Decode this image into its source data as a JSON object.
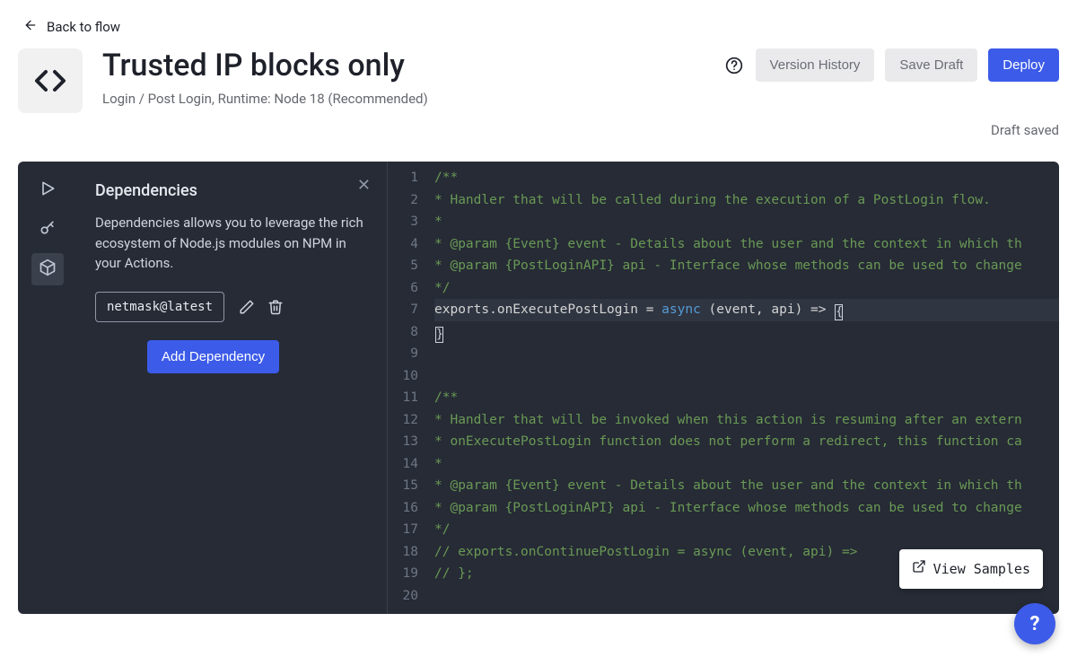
{
  "back_label": "Back to flow",
  "header": {
    "title": "Trusted IP blocks only",
    "subtitle": "Login / Post Login, Runtime: Node 18 (Recommended)",
    "help_tooltip": "Help",
    "version_history": "Version History",
    "save_draft": "Save Draft",
    "deploy": "Deploy",
    "draft_status": "Draft saved"
  },
  "rail": {
    "run": "Run",
    "secrets": "Secrets",
    "dependencies": "Dependencies"
  },
  "panel": {
    "title": "Dependencies",
    "description": "Dependencies allows you to leverage the rich ecosystem of Node.js modules on NPM in your Actions.",
    "dependency": "netmask@latest",
    "edit": "Edit",
    "delete": "Delete",
    "add_button": "Add Dependency"
  },
  "code": {
    "lines": [
      "/**",
      "* Handler that will be called during the execution of a PostLogin flow.",
      "*",
      "* @param {Event} event - Details about the user and the context in which th",
      "* @param {PostLoginAPI} api - Interface whose methods can be used to change",
      "*/",
      "exports.onExecutePostLogin = async (event, api) => {",
      "}",
      "",
      "",
      "/**",
      "* Handler that will be invoked when this action is resuming after an extern",
      "* onExecutePostLogin function does not perform a redirect, this function ca",
      "*",
      "* @param {Event} event - Details about the user and the context in which th",
      "* @param {PostLoginAPI} api - Interface whose methods can be used to change",
      "*/",
      "// exports.onContinuePostLogin = async (event, api) =>",
      "// };",
      ""
    ]
  },
  "view_samples": "View Samples",
  "help_fab": "?"
}
